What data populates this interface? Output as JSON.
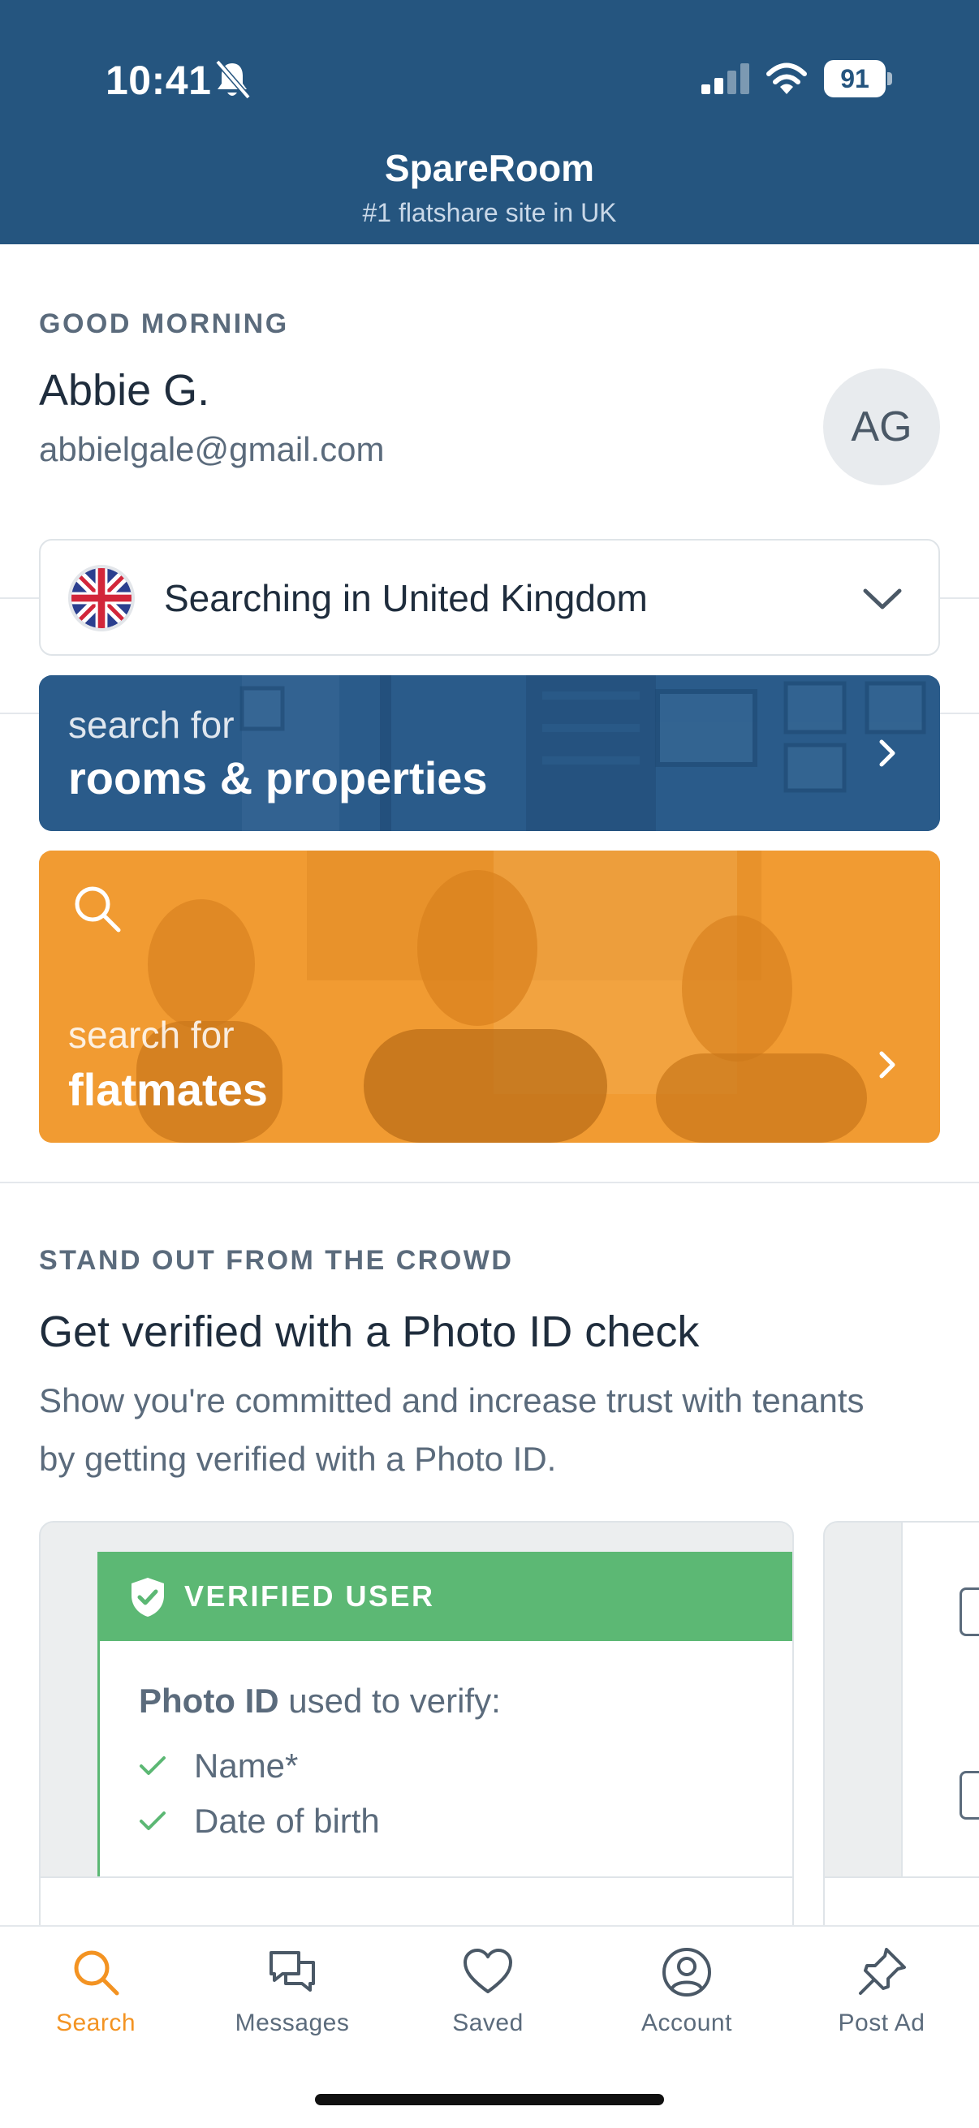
{
  "status_bar": {
    "time": "10:41",
    "battery": "91"
  },
  "header": {
    "title": "SpareRoom",
    "subtitle": "#1 flatshare site in UK"
  },
  "greeting": {
    "label": "GOOD MORNING",
    "name": "Abbie G.",
    "email": "abbielgale@gmail.com",
    "avatar_initials": "AG"
  },
  "location": {
    "label": "Searching in United Kingdom",
    "flag": "uk-flag-icon"
  },
  "search_cards": {
    "rooms": {
      "kicker": "search for",
      "title": "rooms & properties"
    },
    "flatmates": {
      "kicker": "search for",
      "title": "flatmates"
    }
  },
  "verify": {
    "kicker": "STAND OUT FROM THE CROWD",
    "title": "Get verified with a Photo ID check",
    "body": "Show you're committed and increase trust with tenants by getting verified with a Photo ID.",
    "banner": "VERIFIED USER",
    "photo_id_bold": "Photo ID",
    "photo_id_rest": " used to verify:",
    "checks": [
      "Name*",
      "Date of birth"
    ]
  },
  "tabs": [
    {
      "label": "Search",
      "icon": "search-icon",
      "active": true
    },
    {
      "label": "Messages",
      "icon": "messages-icon",
      "active": false
    },
    {
      "label": "Saved",
      "icon": "heart-icon",
      "active": false
    },
    {
      "label": "Account",
      "icon": "account-icon",
      "active": false
    },
    {
      "label": "Post Ad",
      "icon": "pin-icon",
      "active": false
    }
  ],
  "colors": {
    "header": "#25557f",
    "accent_orange": "#f39322",
    "rooms_card": "#2a5b8a",
    "flatmates_card": "#f19b32",
    "verified_green": "#5cb874"
  }
}
